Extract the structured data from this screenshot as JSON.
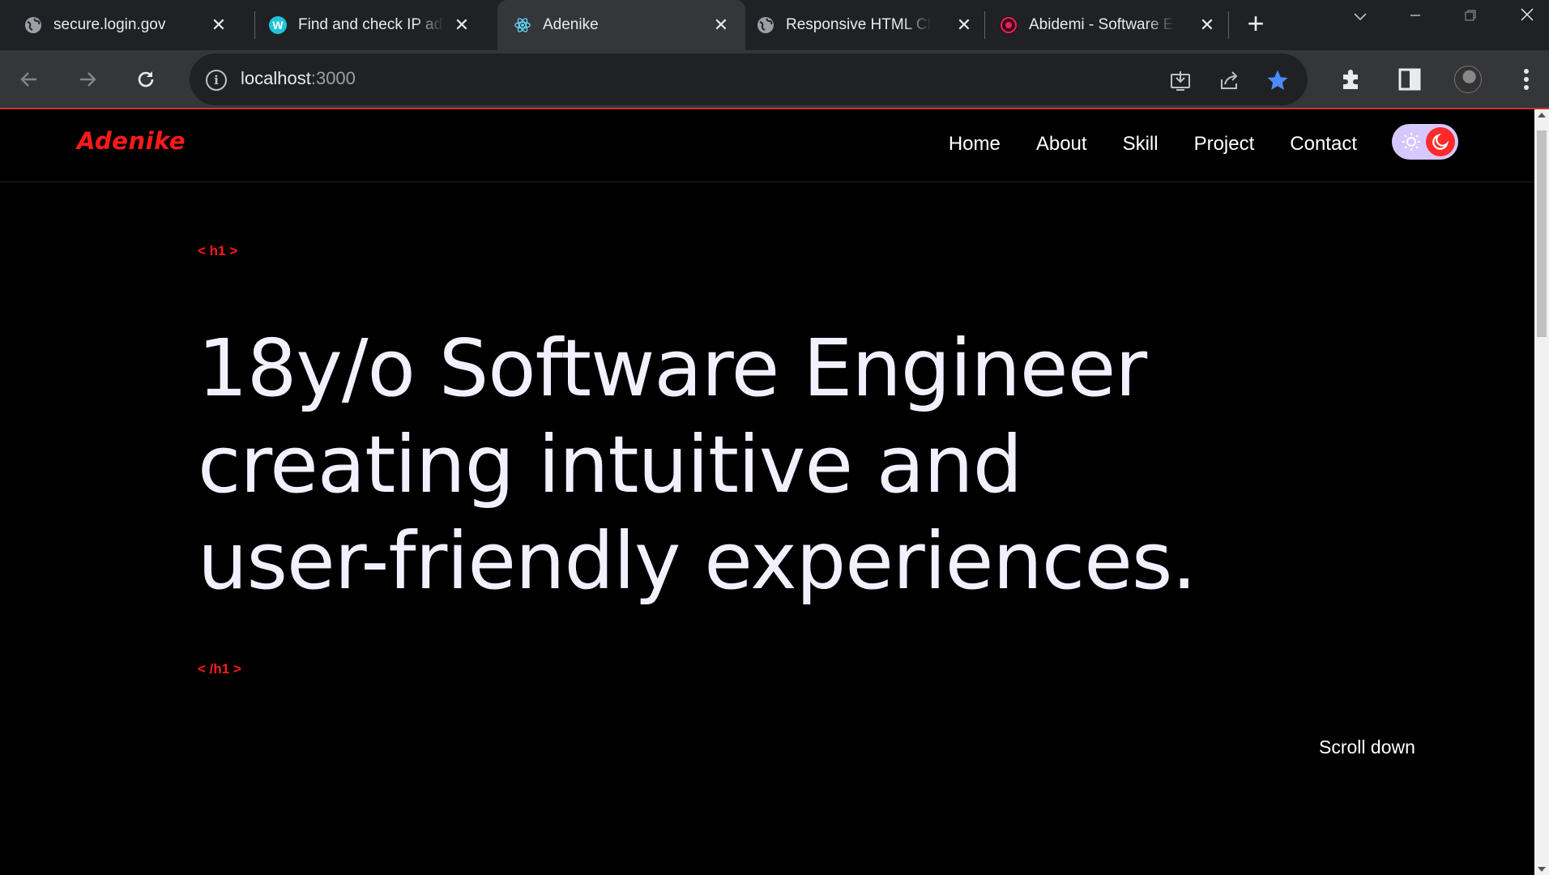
{
  "browser": {
    "tabs": [
      {
        "title": "secure.login.gov",
        "favicon": "globe-icon",
        "active": false
      },
      {
        "title": "Find and check IP add",
        "favicon": "w-logo-icon",
        "active": false
      },
      {
        "title": "Adenike",
        "favicon": "react-icon",
        "active": true
      },
      {
        "title": "Responsive HTML Ch",
        "favicon": "globe-icon",
        "active": false
      },
      {
        "title": "Abidemi - Software En",
        "favicon": "portfolio-icon",
        "active": false
      }
    ],
    "address": {
      "host": "localhost",
      "port": ":3000"
    },
    "bookmark_color": "#4c8bf5"
  },
  "site": {
    "brand": "Adenike",
    "accent": "#ff1a1a",
    "nav": [
      "Home",
      "About",
      "Skill",
      "Project",
      "Contact"
    ],
    "open_tag": "< h1 >",
    "close_tag": "< /h1 >",
    "headline": [
      "18y/o Software Engineer",
      "creating intuitive and",
      "user-friendly experiences."
    ],
    "scroll_label": "Scroll down"
  }
}
